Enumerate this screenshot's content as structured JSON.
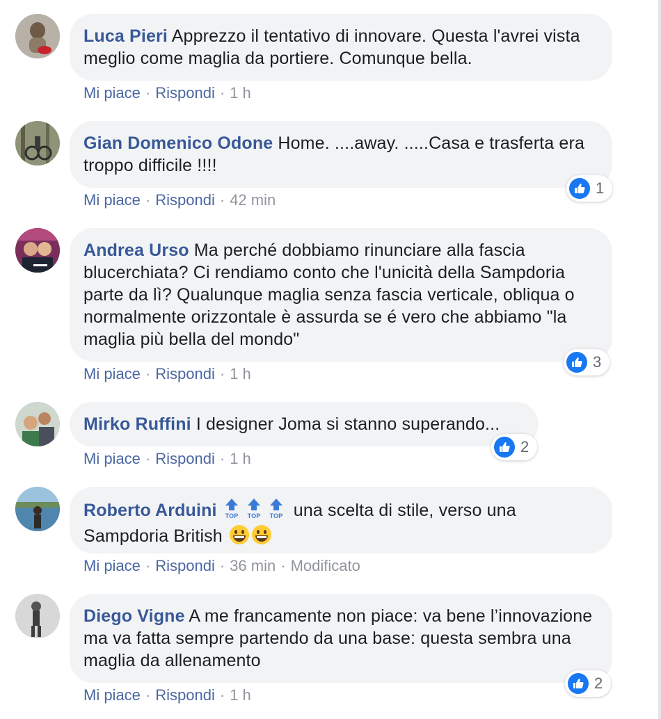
{
  "comments": [
    {
      "author": "Luca Pieri",
      "text": " Apprezzo il tentativo di innovare. Questa l'avrei vista meglio come maglia da portiere. Comunque bella.",
      "like_label": "Mi piace",
      "reply_label": "Rispondi",
      "time": "1 h"
    },
    {
      "author": "Gian Domenico Odone",
      "text": " Home. ....away. .....Casa e trasferta era troppo difficile !!!!",
      "like_label": "Mi piace",
      "reply_label": "Rispondi",
      "time": "42 min",
      "reaction_count": "1"
    },
    {
      "author": "Andrea Urso",
      "text": " Ma perché dobbiamo rinunciare alla fascia blucerchiata? Ci rendiamo conto che l'unicità della Sampdoria parte da lì? Qualunque maglia senza fascia verticale, obliqua o normalmente orizzontale è assurda se é vero che abbiamo \"la maglia più bella del mondo\"",
      "like_label": "Mi piace",
      "reply_label": "Rispondi",
      "time": "1 h",
      "reaction_count": "3"
    },
    {
      "author": "Mirko Ruffini",
      "text": " I designer Joma si stanno superando...",
      "like_label": "Mi piace",
      "reply_label": "Rispondi",
      "time": "1 h",
      "reaction_count": "2"
    },
    {
      "author": "Roberto Arduini",
      "text": " una scelta di stile, verso una Sampdoria British ",
      "top_icon_label": "TOP",
      "like_label": "Mi piace",
      "reply_label": "Rispondi",
      "time": "36 min",
      "edited": "Modificato"
    },
    {
      "author": "Diego Vigne",
      "text": " A me francamente non piace: va bene l’innovazione ma va fatta sempre partendo da una base: questa sembra una maglia da allenamento",
      "like_label": "Mi piace",
      "reply_label": "Rispondi",
      "time": "1 h",
      "reaction_count": "2"
    }
  ],
  "icons": {
    "reaction": "like-thumb-icon",
    "top": "top-arrow-icon",
    "emoji": "grinning-face-icon"
  },
  "colors": {
    "author": "#385898",
    "action_link": "#4b67a1",
    "meta": "#90949c",
    "bubble": "#f2f3f5",
    "like_blue": "#1877f2"
  }
}
